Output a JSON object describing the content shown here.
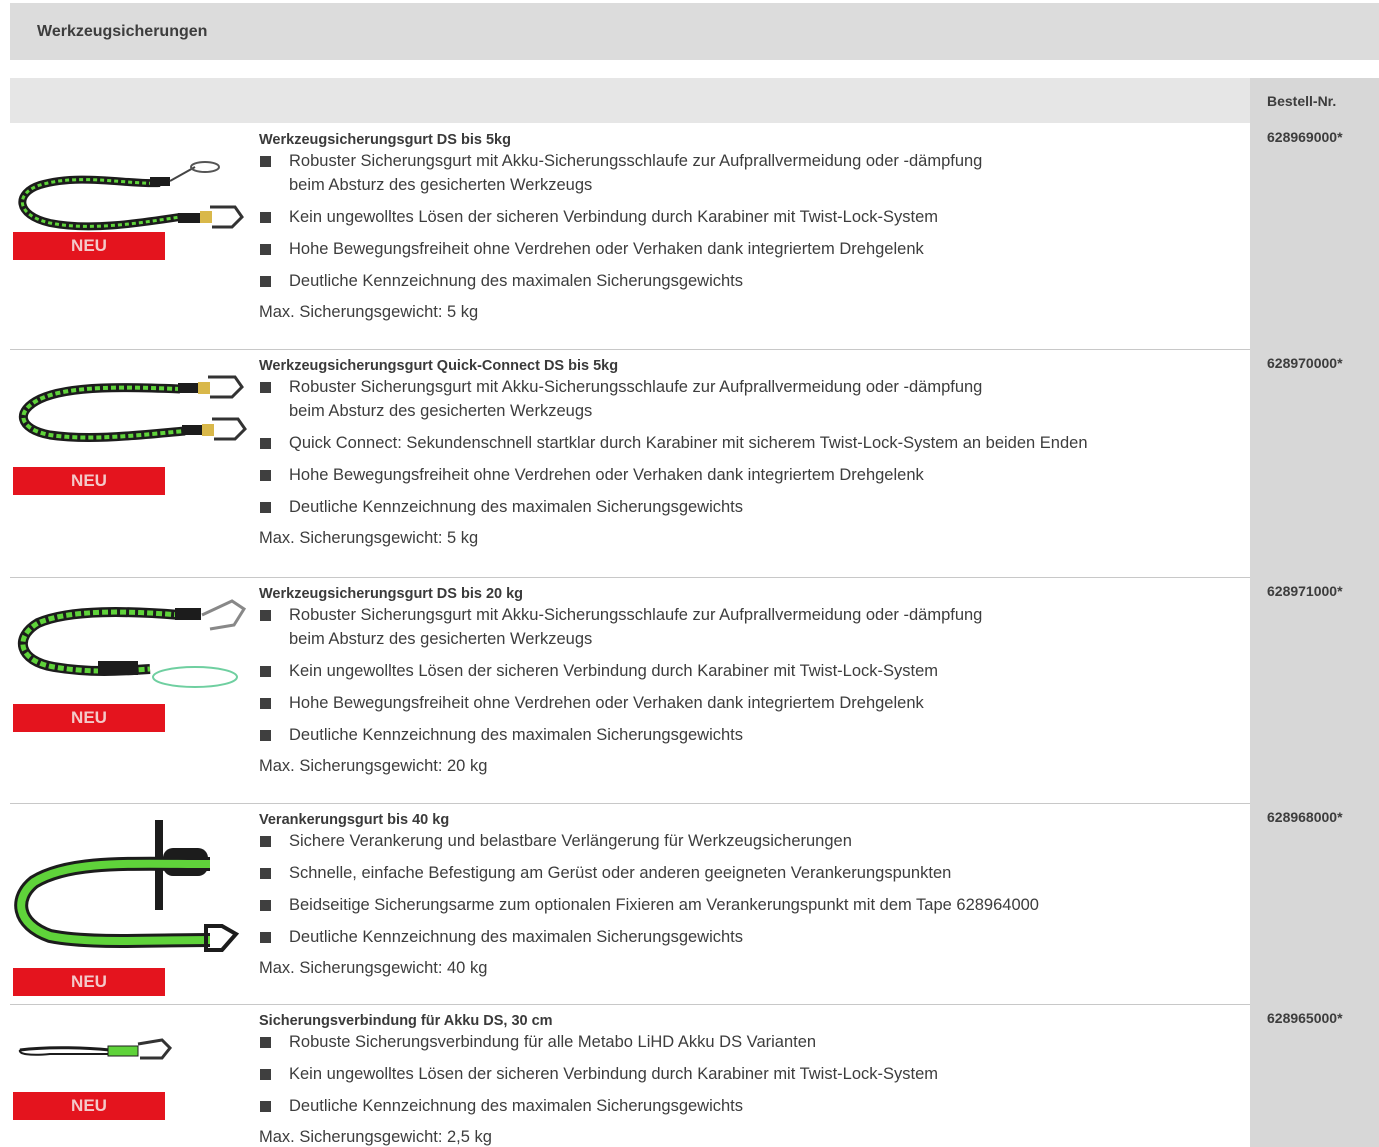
{
  "section_title": "Werkzeugsicherungen",
  "column_header": "Bestell-Nr.",
  "badge_label": "NEU",
  "colors": {
    "badge": "#e4141e",
    "strap_green": "#5fd33a",
    "header_bg": "#dcdcdc",
    "order_bg": "#d7d7d7"
  },
  "products": [
    {
      "title": "Werkzeugsicherungsgurt DS bis 5kg",
      "bullets": [
        "Robuster Sicherungsgurt mit Akku-Sicherungsschlaufe zur Aufprallvermeidung oder -dämpfung\nbeim Absturz des gesicherten Werkzeugs",
        "Kein ungewolltes Lösen der sicheren Verbindung durch Karabiner mit Twist-Lock-System",
        "Hohe Bewegungsfreiheit ohne Verdrehen oder Verhaken dank integriertem Drehgelenk",
        "Deutliche Kennzeichnung des maximalen Sicherungsgewichts"
      ],
      "max_weight": "Max. Sicherungsgewicht: 5 kg",
      "order_no": "628969000*",
      "image_icon": "tool-lanyard-icon"
    },
    {
      "title": "Werkzeugsicherungsgurt Quick-Connect DS bis 5kg",
      "bullets": [
        "Robuster Sicherungsgurt mit Akku-Sicherungsschlaufe zur Aufprallvermeidung oder -dämpfung\nbeim Absturz des gesicherten Werkzeugs",
        "Quick Connect: Sekundenschnell startklar durch Karabiner mit sicherem Twist-Lock-System an beiden Enden",
        "Hohe Bewegungsfreiheit ohne Verdrehen oder Verhaken dank integriertem Drehgelenk",
        "Deutliche Kennzeichnung des maximalen Sicherungsgewichts"
      ],
      "max_weight": "Max. Sicherungsgewicht: 5 kg",
      "order_no": "628970000*",
      "image_icon": "quick-connect-lanyard-icon"
    },
    {
      "title": "Werkzeugsicherungsgurt DS bis 20 kg",
      "bullets": [
        "Robuster Sicherungsgurt mit Akku-Sicherungsschlaufe zur Aufprallvermeidung oder -dämpfung\nbeim Absturz des gesicherten Werkzeugs",
        "Kein ungewolltes Lösen der sicheren Verbindung durch Karabiner mit Twist-Lock-System",
        "Hohe Bewegungsfreiheit ohne Verdrehen oder Verhaken dank integriertem Drehgelenk",
        "Deutliche Kennzeichnung des maximalen Sicherungsgewichts"
      ],
      "max_weight": "Max. Sicherungsgewicht: 20 kg",
      "order_no": "628971000*",
      "image_icon": "heavy-lanyard-icon"
    },
    {
      "title": "Verankerungsgurt bis 40 kg",
      "bullets": [
        "Sichere Verankerung und belastbare Verlängerung für Werkzeugsicherungen",
        "Schnelle, einfache Befestigung am Gerüst oder anderen geeigneten Verankerungspunkten",
        "Beidseitige Sicherungsarme zum optionalen Fixieren am Verankerungspunkt mit dem Tape 628964000",
        "Deutliche Kennzeichnung des maximalen Sicherungsgewichts"
      ],
      "max_weight": "Max. Sicherungsgewicht: 40 kg",
      "order_no": "628968000*",
      "image_icon": "anchor-strap-icon"
    },
    {
      "title": "Sicherungsverbindung für Akku DS, 30 cm",
      "bullets": [
        "Robuste Sicherungsverbindung für alle Metabo LiHD Akku DS Varianten",
        "Kein ungewolltes Lösen der sicheren Verbindung durch Karabiner mit Twist-Lock-System",
        "Deutliche Kennzeichnung des maximalen Sicherungsgewichts"
      ],
      "max_weight": "Max. Sicherungsgewicht: 2,5 kg",
      "order_no": "628965000*",
      "image_icon": "battery-tether-icon"
    }
  ]
}
